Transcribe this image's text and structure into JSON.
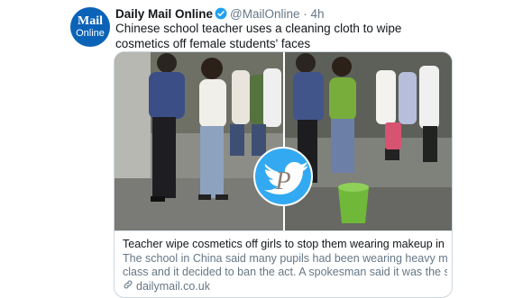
{
  "tweet": {
    "author_name": "Daily Mail Online",
    "handle": "@MailOnline",
    "separator": "·",
    "time": "4h",
    "text": "Chinese school teacher uses a cleaning cloth to wipe cosmetics off female students' faces",
    "avatar": {
      "line1": "Mail",
      "line2": "Online",
      "color": "#0b63b8"
    },
    "verified_color": "#1da1f2"
  },
  "card": {
    "title": "Teacher wipe cosmetics off girls to stop them wearing makeup in school",
    "description_lines": [
      "The school in China said many pupils had been wearing heavy makeup to",
      "class and it decided to ban the act. A spokesman said it was the school'..."
    ],
    "domain": "dailymail.co.uk",
    "link_icon": "link-icon",
    "watermark_icon": "twitter-bird-icon",
    "watermark_letter": "P"
  }
}
